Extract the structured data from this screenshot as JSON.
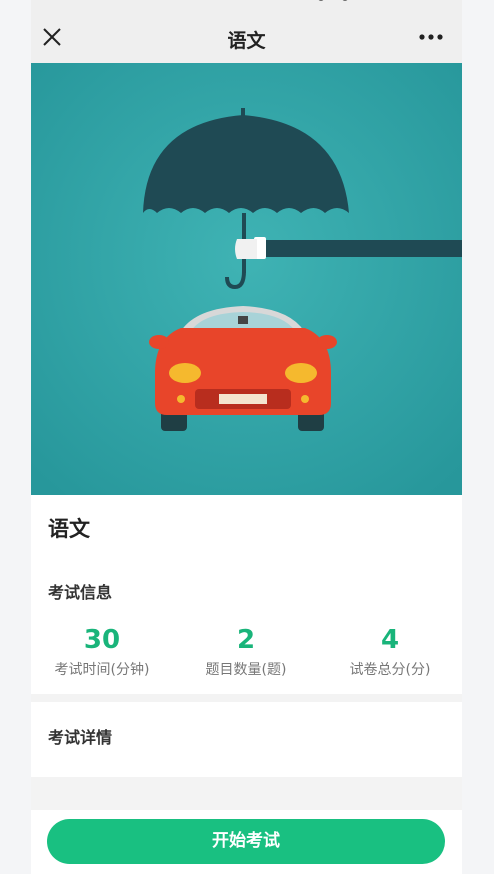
{
  "nav": {
    "title": "语文"
  },
  "course": {
    "title": "语文"
  },
  "exam_info": {
    "section_label": "考试信息",
    "stats": [
      {
        "value": "30",
        "label": "考试时间(分钟)"
      },
      {
        "value": "2",
        "label": "题目数量(题)"
      },
      {
        "value": "4",
        "label": "试卷总分(分)"
      }
    ]
  },
  "exam_detail": {
    "section_label": "考试详情"
  },
  "actions": {
    "start_label": "开始考试"
  },
  "colors": {
    "accent": "#19c081",
    "stat_value": "#19b47a",
    "hero_background": "#2fa3a6"
  },
  "icons": {
    "close": "close-icon",
    "more": "more-dots-icon"
  }
}
